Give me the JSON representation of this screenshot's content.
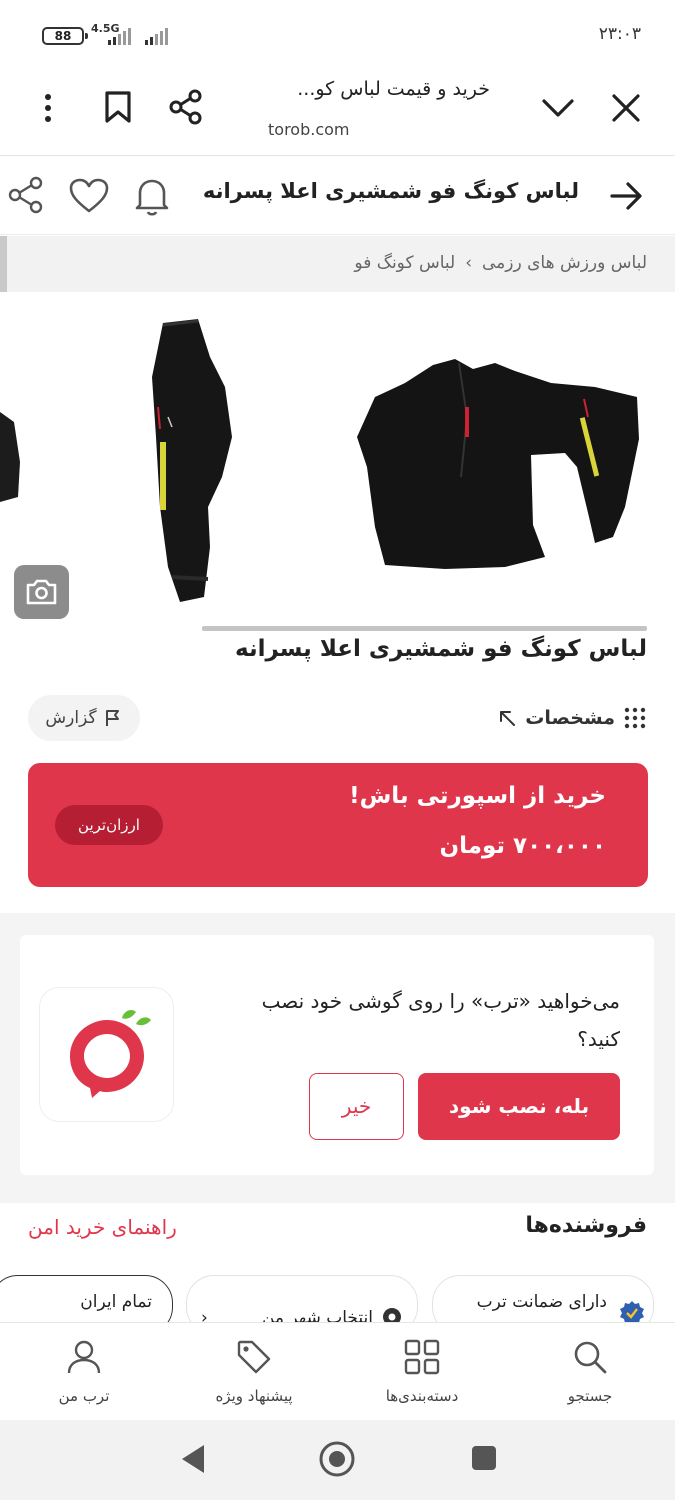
{
  "status_bar": {
    "time": "۲۳:۰۳",
    "battery": "88",
    "network": "4.5G"
  },
  "browser": {
    "title": "خرید و قیمت لباس کو...",
    "url": "torob.com",
    "icons": [
      "close-icon",
      "chevron-down-icon",
      "share-icon",
      "bookmark-icon",
      "more-vert-icon"
    ]
  },
  "header": {
    "title": "لباس کونگ فو شمشیری اعلا پسرانه",
    "icons": [
      "arrow-right-icon",
      "bell-icon",
      "heart-icon",
      "share-icon"
    ]
  },
  "breadcrumb": {
    "items": [
      "لباس ورزش های رزمی",
      "لباس کونگ فو"
    ]
  },
  "product": {
    "title": "لباس کونگ فو شمشیری اعلا پسرانه",
    "specs_label": "مشخصات",
    "report_label": "گزارش"
  },
  "offer": {
    "headline": "خرید از اسپورتی باش!",
    "price": "۷۰۰،۰۰۰ تومان",
    "badge": "ارزان‌ترین"
  },
  "install_banner": {
    "question": "می‌خواهید «ترب» را روی گوشی خود نصب کنید؟",
    "yes_label": "بله، نصب شود",
    "no_label": "خیر"
  },
  "sellers": {
    "title": "فروشنده‌ها",
    "guide_link": "راهنمای خرید امن",
    "chips": {
      "guarantee": "دارای ضمانت ترب",
      "city": "انتخاب شهر من",
      "all_iran": "تمام ایران"
    }
  },
  "bottom_nav": {
    "search": "جستجو",
    "categories": "دسته‌بندی‌ها",
    "offers": "پیشنهاد ویژه",
    "my_torob": "ترب من"
  },
  "colors": {
    "accent": "#e0364c",
    "badge_dark": "#b51e33"
  }
}
